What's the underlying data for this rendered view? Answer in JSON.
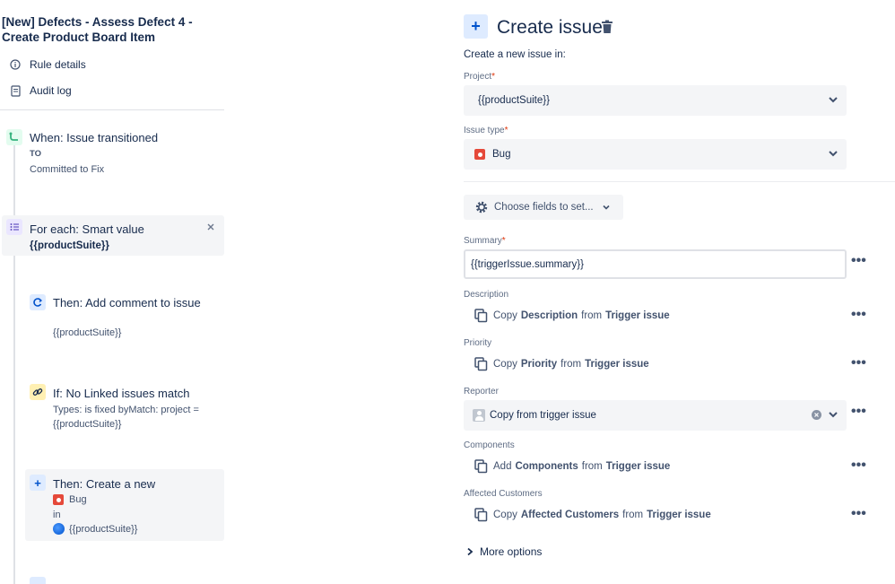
{
  "rule": {
    "title": "[New] Defects - Assess Defect 4 - Create Product Board Item",
    "links": [
      "Rule details",
      "Audit log"
    ]
  },
  "flow": {
    "trigger": {
      "title": "When: Issue transitioned",
      "to_label": "TO",
      "to_value": "Committed to Fix"
    },
    "branch": {
      "title": "For each: Smart value",
      "value": "{{productSuite}}"
    },
    "comment": {
      "title": "Then: Add comment to issue",
      "value": "{{productSuite}}"
    },
    "condition": {
      "title": "If: No Linked issues match",
      "detail": "Types: is fixed byMatch: project = {{productSuite}}"
    },
    "create": {
      "title": "Then: Create a new",
      "type": "Bug",
      "in": "in",
      "project": "{{productSuite}}"
    }
  },
  "panel": {
    "title": "Create issue",
    "intro": "Create a new issue in:",
    "project_label": "Project",
    "project_value": "{{productSuite}}",
    "issuetype_label": "Issue type",
    "issuetype_value": "Bug",
    "choose_fields": "Choose fields to set...",
    "summary_label": "Summary",
    "summary_value": "{{triggerIssue.summary}}",
    "description_label": "Description",
    "priority_label": "Priority",
    "reporter_label": "Reporter",
    "reporter_value": "Copy from trigger issue",
    "components_label": "Components",
    "affected_label": "Affected Customers",
    "more_options": "More options",
    "rows": {
      "description": {
        "verb": "Copy",
        "field": "Description",
        "from": "from",
        "source": "Trigger issue"
      },
      "priority": {
        "verb": "Copy",
        "field": "Priority",
        "from": "from",
        "source": "Trigger issue"
      },
      "components": {
        "verb": "Add",
        "field": "Components",
        "from": "from",
        "source": "Trigger issue"
      },
      "affected": {
        "verb": "Copy",
        "field": "Affected Customers",
        "from": "from",
        "source": "Trigger issue"
      }
    },
    "required_mark": "*"
  },
  "colors": {
    "bug": "#e5493a",
    "accent": "#0052cc",
    "trigger_green": "#36b37e",
    "condition_yellow": "#ffe380",
    "action_blue": "#deebff"
  }
}
